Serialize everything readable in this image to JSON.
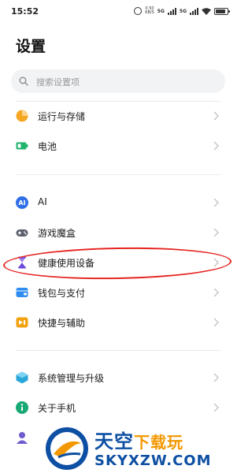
{
  "status_bar": {
    "time": "15:52",
    "speed_value": "0.50",
    "speed_unit": "KB/S",
    "network_1": "5G",
    "network_2": "5G"
  },
  "page": {
    "title": "设置"
  },
  "search": {
    "placeholder": "搜索设置项"
  },
  "groups": [
    {
      "items": [
        {
          "label": "运行与存储",
          "icon": "storage-pie-icon"
        },
        {
          "label": "电池",
          "icon": "battery-icon"
        }
      ]
    },
    {
      "items": [
        {
          "label": "AI",
          "icon": "ai-icon"
        },
        {
          "label": "游戏魔盒",
          "icon": "gamepad-icon"
        },
        {
          "label": "健康使用设备",
          "icon": "hourglass-icon"
        },
        {
          "label": "钱包与支付",
          "icon": "wallet-icon"
        },
        {
          "label": "快捷与辅助",
          "icon": "shortcut-icon"
        }
      ]
    },
    {
      "items": [
        {
          "label": "系统管理与升级",
          "icon": "system-update-icon"
        },
        {
          "label": "关于手机",
          "icon": "info-icon"
        },
        {
          "label": "",
          "icon": "account-icon"
        }
      ]
    }
  ],
  "colors": {
    "accent_highlight": "#e52521",
    "storage_orange": "#f5a623",
    "battery_green": "#1fb36b",
    "ai_blue": "#2f6fe8",
    "hourglass_purple": "#6e49d9",
    "wallet_blue": "#2f8cf0",
    "shortcut_orange": "#f2a20c",
    "system_teal": "#2aa7d9",
    "info_green": "#19a974",
    "account_purple": "#6d5bd0"
  },
  "watermark": {
    "cn_main": "天空",
    "cn_accent": "下载玩",
    "en": "SKYXZW.COM"
  }
}
